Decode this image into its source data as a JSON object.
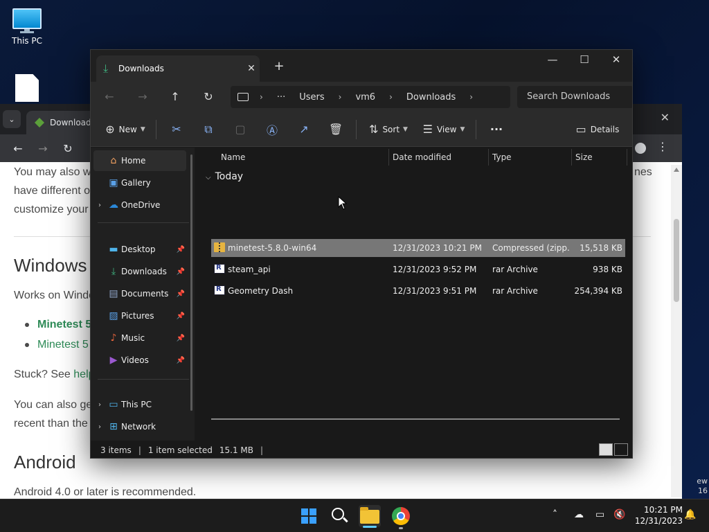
{
  "desktop": {
    "icons": [
      {
        "label": "This PC"
      }
    ]
  },
  "browser": {
    "tab_title": "Downloads",
    "article": {
      "line1": "You may also w",
      "line1_right": "nes",
      "line2": "have different o",
      "line3": "customize your",
      "h_windows": "Windows",
      "works_on": "Works on Windo",
      "link_bold": "Minetest 5",
      "link_plain": "Minetest 5",
      "stuck": "Stuck? See ",
      "stuck_link": "help",
      "also1": "You can also ge",
      "also2": "recent than the",
      "h_android": "Android",
      "android_req": "Android 4.0 or later is recommended."
    },
    "side_peek": [
      "ew",
      "16"
    ]
  },
  "explorer": {
    "tab_title": "Downloads",
    "new_tab_symbol": "+",
    "breadcrumb": [
      "Users",
      "vm6",
      "Downloads"
    ],
    "breadcrumb_more": "···",
    "search_placeholder": "Search Downloads",
    "commands": {
      "new": "New",
      "sort": "Sort",
      "view": "View",
      "more": "···",
      "details": "Details"
    },
    "nav": {
      "home": "Home",
      "gallery": "Gallery",
      "onedrive": "OneDrive",
      "desktop": "Desktop",
      "downloads": "Downloads",
      "documents": "Documents",
      "pictures": "Pictures",
      "music": "Music",
      "videos": "Videos",
      "thispc": "This PC",
      "network": "Network"
    },
    "columns": {
      "name": "Name",
      "date": "Date modified",
      "type": "Type",
      "size": "Size"
    },
    "group_label": "Today",
    "files": [
      {
        "name": "minetest-5.8.0-win64",
        "date": "12/31/2023 10:21 PM",
        "type": "Compressed (zipp...",
        "size": "15,518 KB",
        "icon": "zip-icon",
        "selected": true
      },
      {
        "name": "steam_api",
        "date": "12/31/2023 9:52 PM",
        "type": "rar Archive",
        "size": "938 KB",
        "icon": "rar-icon",
        "selected": false
      },
      {
        "name": "Geometry Dash",
        "date": "12/31/2023 9:51 PM",
        "type": "rar Archive",
        "size": "254,394 KB",
        "icon": "rar-icon",
        "selected": false
      }
    ],
    "status": {
      "items": "3 items",
      "selected": "1 item selected",
      "size": "15.1 MB"
    }
  },
  "taskbar": {
    "time": "10:21 PM",
    "date": "12/31/2023"
  },
  "colors": {
    "accent": "#60cdff",
    "selection": "#777777",
    "download_green": "#3fb27f"
  }
}
